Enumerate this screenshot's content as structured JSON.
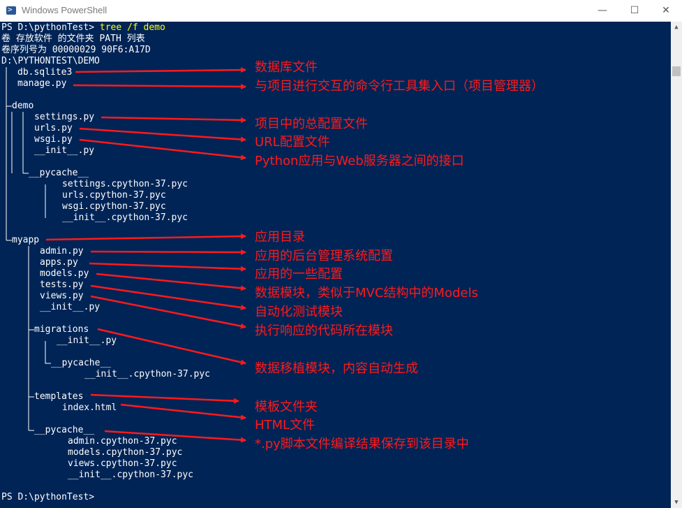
{
  "window": {
    "title": "Windows PowerShell",
    "icon": "powershell-icon",
    "minimize": "—",
    "maximize": "☐",
    "close": "✕"
  },
  "console": {
    "prompt1": "PS D:\\pythonTest>",
    "command": "tree /f demo",
    "header1": "卷 存放软件 的文件夹 PATH 列表",
    "header2": "卷序列号为 00000029 90F6:A17D",
    "root": "D:\\PYTHONTEST\\DEMO",
    "tree": [
      "db.sqlite3",
      "manage.py",
      "demo",
      "settings.py",
      "urls.py",
      "wsgi.py",
      "__init__.py",
      "__pycache__",
      "settings.cpython-37.pyc",
      "urls.cpython-37.pyc",
      "wsgi.cpython-37.pyc",
      "__init__.cpython-37.pyc",
      "myapp",
      "admin.py",
      "apps.py",
      "models.py",
      "tests.py",
      "views.py",
      "__init__.py",
      "migrations",
      "__init__.py",
      "__pycache__",
      "__init__.cpython-37.pyc",
      "templates",
      "index.html",
      "__pycache__",
      "admin.cpython-37.pyc",
      "models.cpython-37.pyc",
      "views.cpython-37.pyc",
      "__init__.cpython-37.pyc"
    ],
    "prompt2": "PS D:\\pythonTest>"
  },
  "annotations": [
    "数据库文件",
    "与项目进行交互的命令行工具集入口（项目管理器）",
    "项目中的总配置文件",
    "URL配置文件",
    "Python应用与Web服务器之间的接口",
    "应用目录",
    "应用的后台管理系统配置",
    "应用的一些配置",
    "数据模块，类似于MVC结构中的Models",
    "自动化测试模块",
    "执行响应的代码所在模块",
    "数据移植模块，内容自动生成",
    "模板文件夹",
    "HTML文件",
    "*.py脚本文件编译结果保存到该目录中"
  ],
  "colors": {
    "console_bg": "#012456",
    "text": "#ffffff",
    "command": "#ffff00",
    "annotation": "#ff1a1a"
  }
}
